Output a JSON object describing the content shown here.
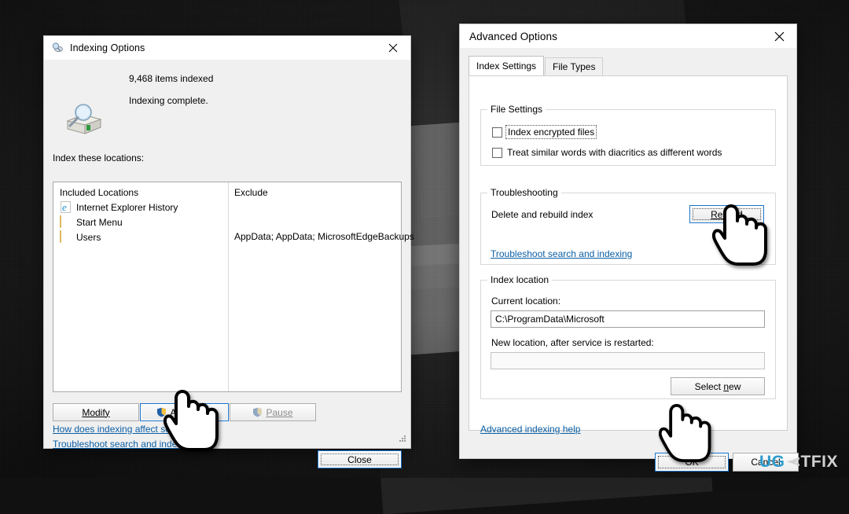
{
  "watermark": {
    "part1": "UG",
    "part3": "TFIX"
  },
  "indexing_dialog": {
    "title": "Indexing Options",
    "title_icon": "indexing-options-icon",
    "close_icon": "close-icon",
    "status_icon": "drive-search-icon",
    "items_indexed": "9,468 items indexed",
    "status_text": "Indexing complete.",
    "locations_label": "Index these locations:",
    "list": {
      "col_included": "Included Locations",
      "col_exclude": "Exclude",
      "rows": [
        {
          "icon": "internet-explorer-icon",
          "name": "Internet Explorer History",
          "exclude": ""
        },
        {
          "icon": "folder-icon",
          "name": "Start Menu",
          "exclude": ""
        },
        {
          "icon": "folder-icon",
          "name": "Users",
          "exclude": "AppData; AppData; MicrosoftEdgeBackups"
        }
      ]
    },
    "buttons": {
      "modify": "Modify",
      "advanced": "Advanced",
      "pause": "Pause",
      "close": "Close"
    },
    "links": {
      "how_does": "How does indexing affect searches?",
      "troubleshoot": "Troubleshoot search and indexing"
    }
  },
  "advanced_dialog": {
    "title": "Advanced Options",
    "close_icon": "close-icon",
    "tabs": [
      {
        "label": "Index Settings",
        "active": true
      },
      {
        "label": "File Types",
        "active": false
      }
    ],
    "file_settings": {
      "legend": "File Settings",
      "checkbox_encrypted": "Index encrypted files",
      "checkbox_diacritics": "Treat similar words with diacritics as different words",
      "encrypted_checked": false,
      "diacritics_checked": false
    },
    "troubleshooting": {
      "legend": "Troubleshooting",
      "delete_rebuild_label": "Delete and rebuild index",
      "rebuild_button": "Rebuild",
      "link": "Troubleshoot search and indexing"
    },
    "index_location": {
      "legend": "Index location",
      "current_label": "Current location:",
      "current_value": "C:\\ProgramData\\Microsoft",
      "new_label": "New location, after service is restarted:",
      "new_value": "",
      "select_new_button": "Select new"
    },
    "help_link": "Advanced indexing help",
    "buttons": {
      "ok": "OK",
      "cancel": "Cancel"
    }
  }
}
